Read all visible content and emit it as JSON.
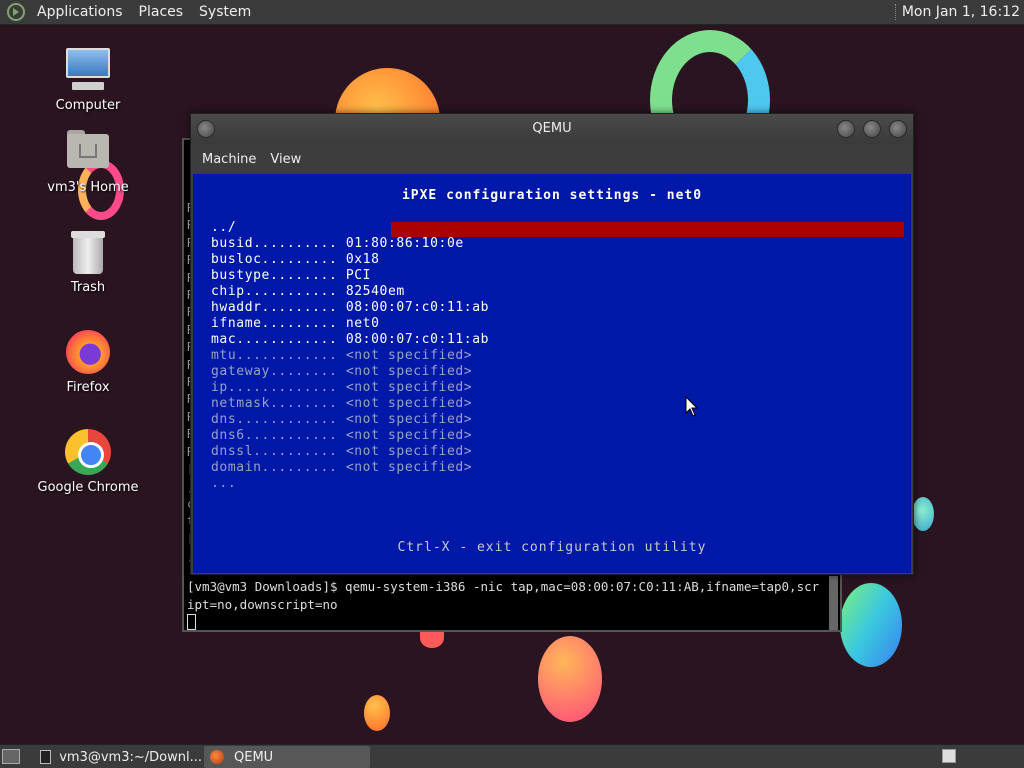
{
  "top_panel": {
    "menus": [
      "Applications",
      "Places",
      "System"
    ],
    "clock": "Mon Jan  1, 16:12"
  },
  "desktop_icons": [
    {
      "label": "Computer",
      "icon": "computer-icon"
    },
    {
      "label": "vm3's Home",
      "icon": "home-folder-icon"
    },
    {
      "label": "Trash",
      "icon": "trash-icon"
    },
    {
      "label": "Firefox",
      "icon": "firefox-icon"
    },
    {
      "label": "Google Chrome",
      "icon": "chrome-icon"
    }
  ],
  "terminal": {
    "gutter_lines": [
      "R",
      "R",
      "R",
      "R",
      "R",
      "R",
      "R",
      "R",
      "R",
      "R",
      "R",
      "R",
      "R",
      "R",
      "R",
      "[",
      ",",
      "c",
      "t",
      "[",
      ","
    ],
    "command": "[vm3@vm3 Downloads]$ qemu-system-i386 -nic tap,mac=08:00:07:C0:11:AB,ifname=tap0,script=no,downscript=no"
  },
  "qemu": {
    "title": "QEMU",
    "menus": [
      "Machine",
      "View"
    ],
    "screen": {
      "heading": "iPXE configuration settings - net0",
      "rows": [
        {
          "text": "../",
          "set": true
        },
        {
          "text": "busid.......... 01:80:86:10:0e",
          "set": true
        },
        {
          "text": "busloc......... 0x18",
          "set": true
        },
        {
          "text": "bustype........ PCI",
          "set": true
        },
        {
          "text": "chip........... 82540em",
          "set": true
        },
        {
          "text": "hwaddr......... 08:00:07:c0:11:ab",
          "set": true
        },
        {
          "text": "ifname......... net0",
          "set": true
        },
        {
          "text": "mac............ 08:00:07:c0:11:ab",
          "set": true
        },
        {
          "text": "mtu............ <not specified>",
          "set": false
        },
        {
          "text": "gateway........ <not specified>",
          "set": false
        },
        {
          "text": "ip............. <not specified>",
          "set": false
        },
        {
          "text": "netmask........ <not specified>",
          "set": false
        },
        {
          "text": "dns............ <not specified>",
          "set": false
        },
        {
          "text": "dns6........... <not specified>",
          "set": false
        },
        {
          "text": "dnssl.......... <not specified>",
          "set": false
        },
        {
          "text": "domain......... <not specified>",
          "set": false
        },
        {
          "text": "...",
          "set": false
        }
      ],
      "footer": "Ctrl-X - exit configuration utility"
    }
  },
  "taskbar": {
    "tasks": [
      {
        "label": "vm3@vm3:~/Downl...",
        "active": false
      },
      {
        "label": "QEMU",
        "active": true
      }
    ]
  },
  "colors": {
    "ipxe_bg": "#0018a8",
    "selection": "#aa0000",
    "panel": "#3b3b3b"
  }
}
